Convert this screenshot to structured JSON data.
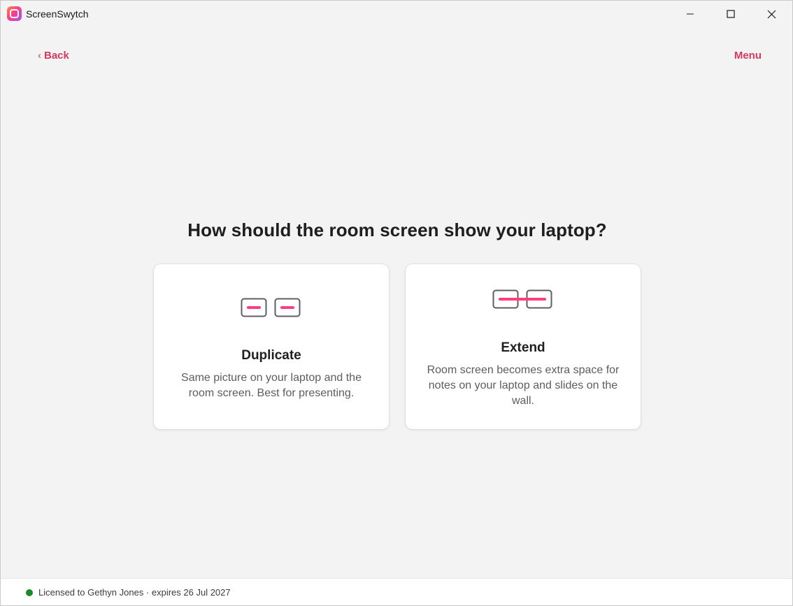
{
  "window": {
    "app_title": "ScreenSwytch",
    "controls": {
      "minimize_icon": "minimize-icon",
      "maximize_icon": "maximize-icon",
      "close_icon": "close-icon"
    }
  },
  "header": {
    "back_chevron": "‹",
    "back_label": "Back",
    "menu_label": "Menu",
    "accent_color": "#d23a5e"
  },
  "main": {
    "question": "How should the room screen show your laptop?",
    "options": [
      {
        "title": "Duplicate",
        "description": "Same picture on your laptop and the room screen. Best for presenting.",
        "icon": "duplicate-screens-icon"
      },
      {
        "title": "Extend",
        "description": "Room screen becomes extra space for notes on your laptop and slides on the wall.",
        "icon": "extend-screens-icon"
      }
    ],
    "icon_accent_color": "#ff3d7f"
  },
  "footer": {
    "license_text": "Licensed to Gethyn Jones · expires 26 Jul 2027",
    "status_color": "#1a8a2e"
  }
}
